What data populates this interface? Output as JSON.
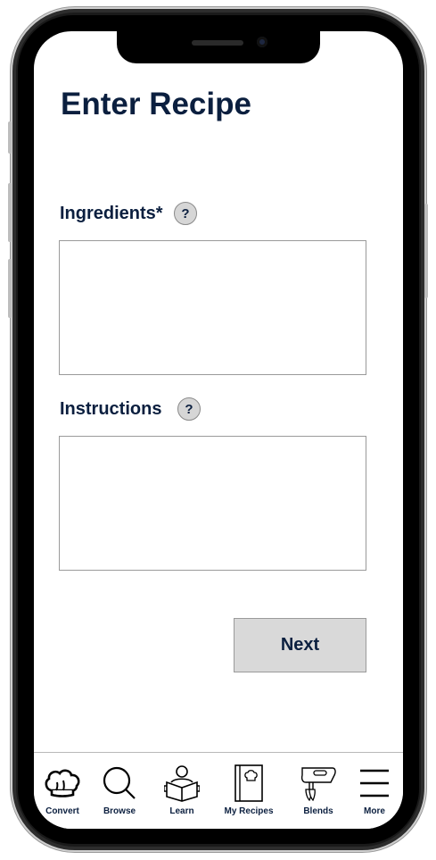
{
  "page": {
    "title": "Enter Recipe"
  },
  "form": {
    "ingredients_label": "Ingredients*",
    "ingredients_help": "?",
    "ingredients_value": "",
    "instructions_label": "Instructions",
    "instructions_help": "?",
    "instructions_value": "",
    "next_label": "Next"
  },
  "tabs": [
    {
      "label": "Convert",
      "icon": "chef-hat-icon"
    },
    {
      "label": "Browse",
      "icon": "search-icon"
    },
    {
      "label": "Learn",
      "icon": "reader-icon"
    },
    {
      "label": "My Recipes",
      "icon": "recipe-book-icon"
    },
    {
      "label": "Blends",
      "icon": "hand-mixer-icon"
    },
    {
      "label": "More",
      "icon": "menu-icon"
    }
  ]
}
